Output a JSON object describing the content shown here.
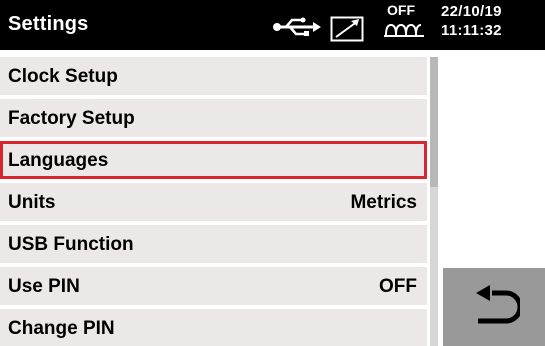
{
  "header": {
    "title": "Settings",
    "status": "OFF",
    "date": "22/10/19",
    "time": "11:11:32",
    "icons": [
      "usb-icon",
      "arrow-box-icon",
      "wave-icon"
    ]
  },
  "menu": {
    "items": [
      {
        "label": "Clock Setup",
        "value": ""
      },
      {
        "label": "Factory Setup",
        "value": ""
      },
      {
        "label": "Languages",
        "value": "",
        "selected": true
      },
      {
        "label": "Units",
        "value": "Metrics"
      },
      {
        "label": "USB Function",
        "value": ""
      },
      {
        "label": "Use PIN",
        "value": "OFF"
      },
      {
        "label": "Change PIN",
        "value": ""
      }
    ]
  },
  "back_button": {
    "icon": "return-arrow-icon"
  },
  "colors": {
    "header_bg": "#000000",
    "item_bg": "#ece8e8",
    "selected_border": "#d7262c",
    "back_button_bg": "#999999"
  }
}
